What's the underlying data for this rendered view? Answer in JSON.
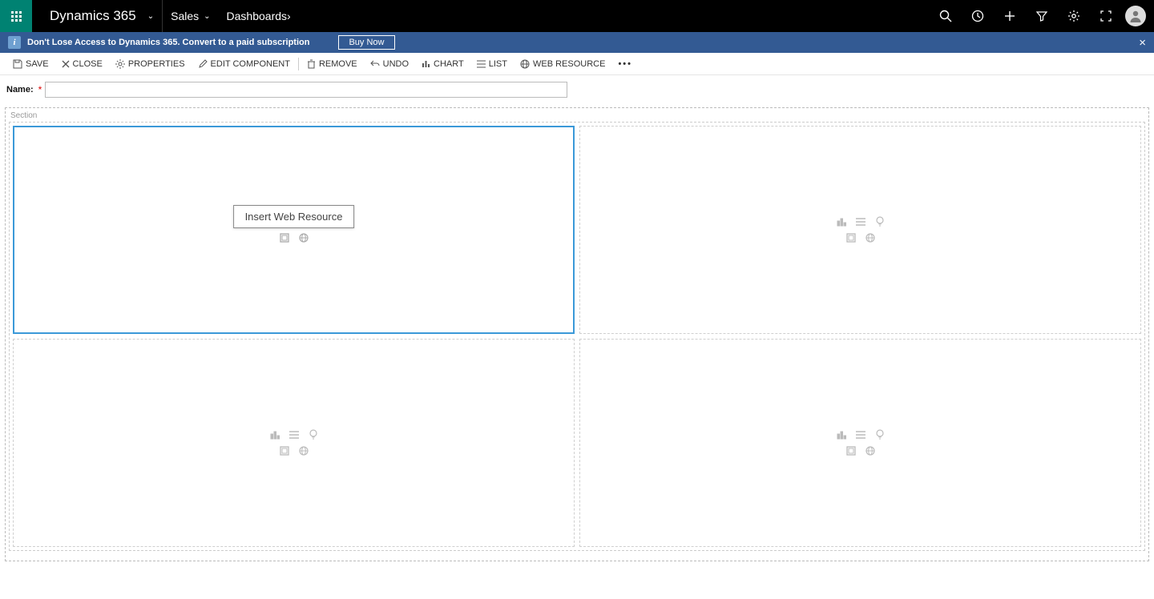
{
  "nav": {
    "brand": "Dynamics 365",
    "app": "Sales",
    "breadcrumb": "Dashboards"
  },
  "notice": {
    "text": "Don't Lose Access to Dynamics 365. Convert to a paid subscription",
    "button": "Buy Now"
  },
  "commands": {
    "save": "SAVE",
    "close": "CLOSE",
    "properties": "PROPERTIES",
    "edit_component": "EDIT COMPONENT",
    "remove": "REMOVE",
    "undo": "UNDO",
    "chart": "CHART",
    "list": "LIST",
    "web_resource": "WEB RESOURCE"
  },
  "form": {
    "name_label": "Name:",
    "name_value": ""
  },
  "canvas": {
    "section_label": "Section",
    "tooltip": "Insert Web Resource"
  },
  "icons": {
    "chart": "chart-icon",
    "list": "list-icon",
    "insights": "insights-icon",
    "iframe": "iframe-icon",
    "web": "web-icon"
  }
}
